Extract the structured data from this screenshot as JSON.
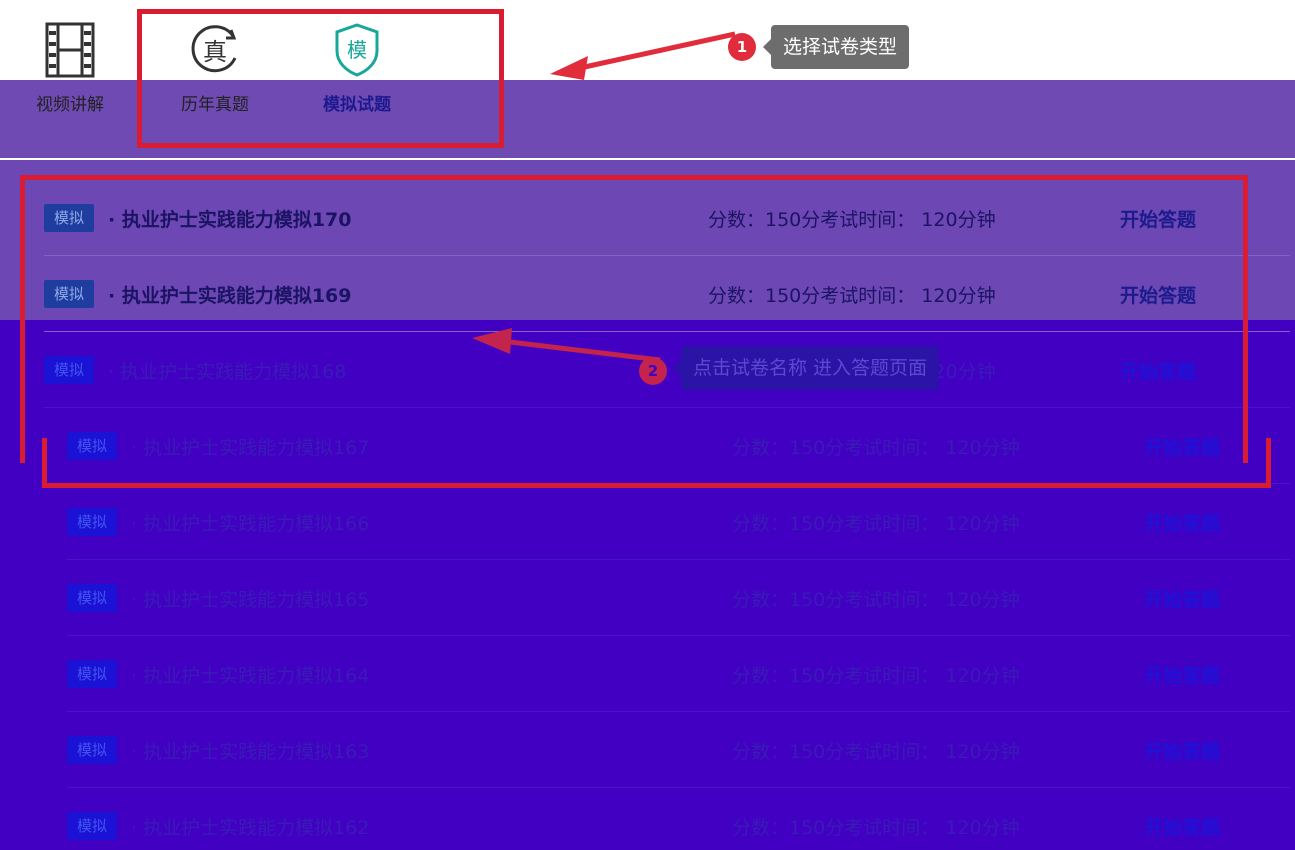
{
  "tabs": [
    {
      "label": "视频讲解",
      "icon": "film-icon",
      "active": false
    },
    {
      "label": "历年真题",
      "icon": "zhen-icon",
      "active": false
    },
    {
      "label": "模拟试题",
      "icon": "mo-shield-icon",
      "active": true
    }
  ],
  "icon_glyphs": {
    "zhen": "真",
    "mo": "模"
  },
  "callouts": [
    {
      "number": "1",
      "text": "选择试卷类型"
    },
    {
      "number": "2",
      "text": "点击试卷名称 进入答题页面"
    }
  ],
  "exam_rows": [
    {
      "tag": "模拟",
      "title": "· 执业护士实践能力模拟170",
      "meta": "分数：150分考试时间： 120分钟",
      "action": "开始答题"
    },
    {
      "tag": "模拟",
      "title": "· 执业护士实践能力模拟169",
      "meta": "分数：150分考试时间： 120分钟",
      "action": "开始答题"
    },
    {
      "tag": "模拟",
      "title": "· 执业护士实践能力模拟168",
      "meta": "分数：150分考试时间： 120分钟",
      "action": "开始答题"
    },
    {
      "tag": "模拟",
      "title": "· 执业护士实践能力模拟167",
      "meta": "分数：150分考试时间： 120分钟",
      "action": "开始答题"
    },
    {
      "tag": "模拟",
      "title": "· 执业护士实践能力模拟166",
      "meta": "分数：150分考试时间： 120分钟",
      "action": "开始答题"
    },
    {
      "tag": "模拟",
      "title": "· 执业护士实践能力模拟165",
      "meta": "分数：150分考试时间： 120分钟",
      "action": "开始答题"
    },
    {
      "tag": "模拟",
      "title": "· 执业护士实践能力模拟164",
      "meta": "分数：150分考试时间： 120分钟",
      "action": "开始答题"
    },
    {
      "tag": "模拟",
      "title": "· 执业护士实践能力模拟163",
      "meta": "分数：150分考试时间： 120分钟",
      "action": "开始答题"
    },
    {
      "tag": "模拟",
      "title": "· 执业护士实践能力模拟162",
      "meta": "分数：150分考试时间： 120分钟",
      "action": "开始答题"
    }
  ],
  "colors": {
    "highlight_red": "#d91c32",
    "accent_teal": "#17a89a",
    "overlay_purple": "#6e4ab2",
    "overlay_blue": "#4100c2"
  }
}
